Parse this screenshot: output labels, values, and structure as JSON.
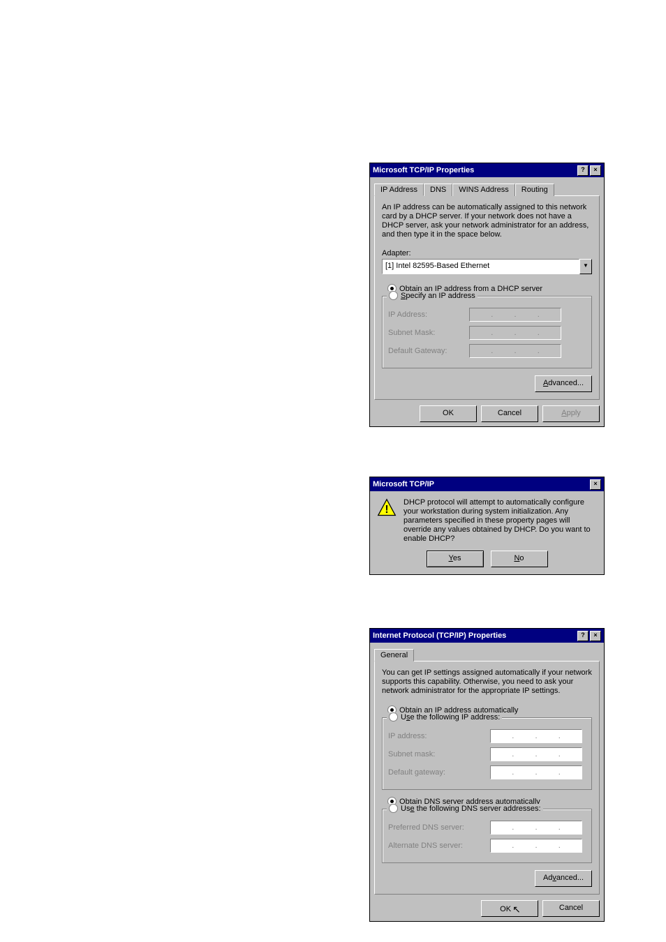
{
  "dlg1": {
    "title": "Microsoft TCP/IP Properties",
    "tabs": [
      "IP Address",
      "DNS",
      "WINS Address",
      "Routing"
    ],
    "desc": "An IP address can be automatically assigned to this network card by a DHCP server. If your network does not have a DHCP server, ask your network administrator for an address, and then type it in the space below.",
    "adapter_label": "Adapter:",
    "adapter_value": "[1] Intel 82595-Based Ethernet",
    "radio_dhcp": "Obtain an IP address from a DHCP server",
    "radio_specify": "Specify an IP address",
    "field_ip": "IP Address:",
    "field_mask": "Subnet Mask:",
    "field_gw": "Default Gateway:",
    "btn_advanced": "Advanced...",
    "btn_ok": "OK",
    "btn_cancel": "Cancel",
    "btn_apply": "Apply"
  },
  "dlg2": {
    "title": "Microsoft TCP/IP",
    "message": "DHCP protocol will attempt to automatically configure your workstation during system initialization. Any parameters specified in these property pages will override any values obtained by DHCP. Do you want to enable DHCP?",
    "btn_yes": "Yes",
    "btn_no": "No"
  },
  "dlg3": {
    "title": "Internet Protocol (TCP/IP) Properties",
    "tab_general": "General",
    "desc": "You can get IP settings assigned automatically if your network supports this capability. Otherwise, you need to ask your network administrator for the appropriate IP settings.",
    "radio_obtain_ip": "Obtain an IP address automatically",
    "radio_use_ip": "Use the following IP address:",
    "field_ip": "IP address:",
    "field_mask": "Subnet mask:",
    "field_gw": "Default gateway:",
    "radio_obtain_dns": "Obtain DNS server address automatically",
    "radio_use_dns": "Use the following DNS server addresses:",
    "field_pref_dns": "Preferred DNS server:",
    "field_alt_dns": "Alternate DNS server:",
    "btn_advanced": "Advanced...",
    "btn_ok": "OK",
    "btn_cancel": "Cancel"
  },
  "glyph": {
    "help": "?",
    "close": "×",
    "down": "▼"
  }
}
